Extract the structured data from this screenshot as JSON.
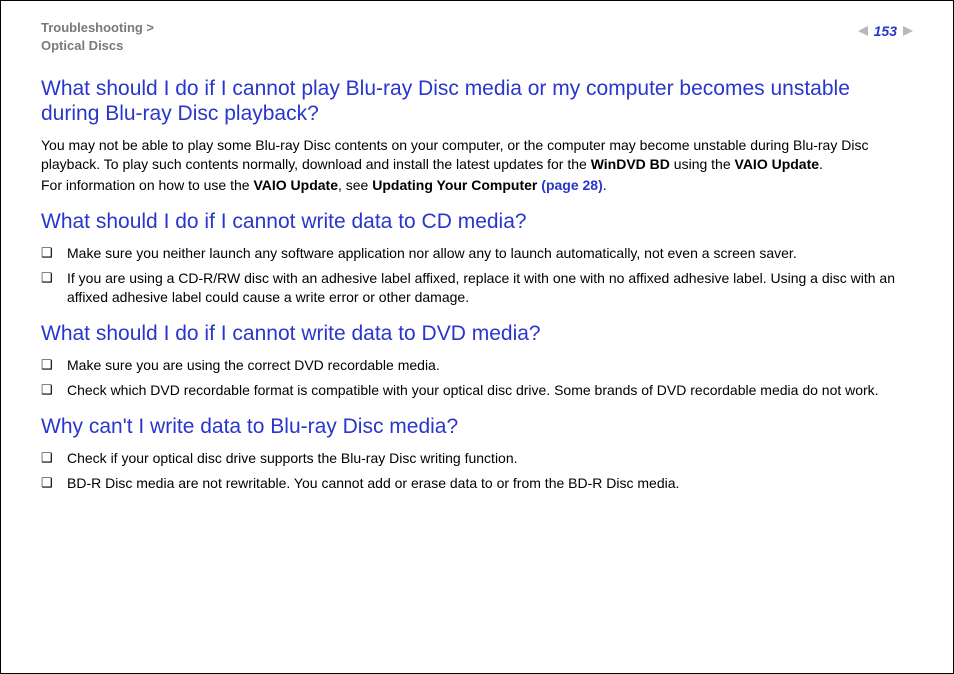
{
  "header": {
    "breadcrumb_line1": "Troubleshooting >",
    "breadcrumb_line2": "Optical Discs",
    "page_number": "153"
  },
  "section1": {
    "heading": "What should I do if I cannot play Blu-ray Disc media or my computer becomes unstable during Blu-ray Disc playback?",
    "p1_a": "You may not be able to play some Blu-ray Disc contents on your computer, or the computer may become unstable during Blu-ray Disc playback. To play such contents normally, download and install the latest updates for the ",
    "p1_bold1": "WinDVD BD",
    "p1_b": " using the ",
    "p1_bold2": "VAIO Update",
    "p1_c": ".",
    "p2_a": "For information on how to use the ",
    "p2_bold1": "VAIO Update",
    "p2_b": ", see ",
    "p2_bold2": "Updating Your Computer ",
    "p2_link": "(page 28)",
    "p2_c": "."
  },
  "section2": {
    "heading": "What should I do if I cannot write data to CD media?",
    "items": [
      "Make sure you neither launch any software application nor allow any to launch automatically, not even a screen saver.",
      "If you are using a CD-R/RW disc with an adhesive label affixed, replace it with one with no affixed adhesive label. Using a disc with an affixed adhesive label could cause a write error or other damage."
    ]
  },
  "section3": {
    "heading": "What should I do if I cannot write data to DVD media?",
    "items": [
      "Make sure you are using the correct DVD recordable media.",
      "Check which DVD recordable format is compatible with your optical disc drive. Some brands of DVD recordable media do not work."
    ]
  },
  "section4": {
    "heading": "Why can't I write data to Blu-ray Disc media?",
    "items": [
      "Check if your optical disc drive supports the Blu-ray Disc writing function.",
      "BD-R Disc media are not rewritable. You cannot add or erase data to or from the BD-R Disc media."
    ]
  },
  "bullet_glyph": "❑"
}
